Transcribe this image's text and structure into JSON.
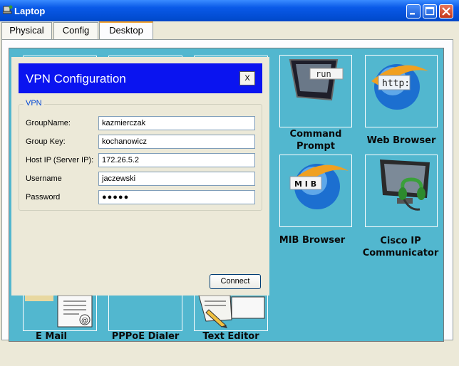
{
  "window": {
    "title": "Laptop"
  },
  "tabs": [
    {
      "label": "Physical"
    },
    {
      "label": "Config"
    },
    {
      "label": "Desktop",
      "active": true
    }
  ],
  "desktop": {
    "background_color": "#52B7CF",
    "icons": [
      {
        "label": "Command Prompt",
        "icon": "command-prompt-icon",
        "icon_text": "run"
      },
      {
        "label": "Web Browser",
        "icon": "web-browser-icon",
        "icon_text": "http:"
      },
      {
        "label": "MIB Browser",
        "icon": "mib-browser-icon",
        "icon_text": "M I B"
      },
      {
        "label": "Cisco IP Communicator",
        "icon": "ip-communicator-icon"
      },
      {
        "label": "E Mail",
        "icon": "email-icon"
      },
      {
        "label": "PPPoE Dialer",
        "icon": "pppoe-dialer-icon"
      },
      {
        "label": "Text Editor",
        "icon": "text-editor-icon"
      }
    ]
  },
  "vpn_dialog": {
    "title": "VPN Configuration",
    "close_label": "X",
    "header_color": "#0A14F0",
    "group_legend": "VPN",
    "fields": [
      {
        "label": "GroupName:",
        "value": "kazmierczak"
      },
      {
        "label": "Group Key:",
        "value": "kochanowicz"
      },
      {
        "label": "Host IP (Server IP):",
        "value": "172.26.5.2"
      },
      {
        "label": "Username",
        "value": "jaczewski"
      },
      {
        "label": "Password",
        "value": "●●●●●"
      }
    ],
    "connect_label": "Connect"
  }
}
